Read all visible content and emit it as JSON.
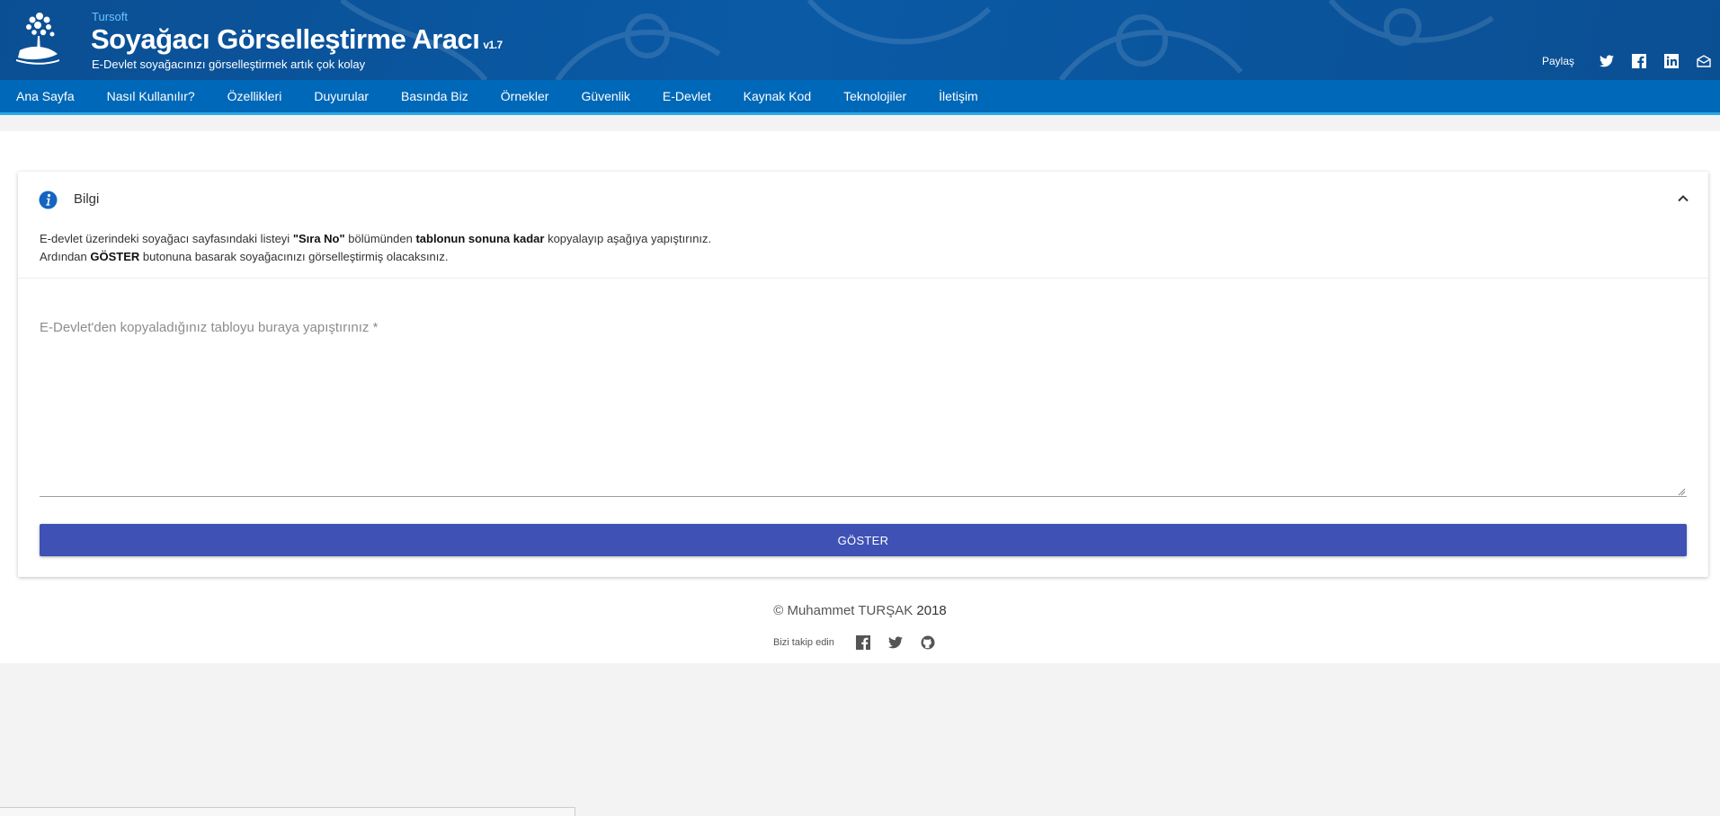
{
  "header": {
    "brand": "Tursoft",
    "title": "Soyağacı Görselleştirme Aracı",
    "version": "v1.7",
    "subtitle": "E-Devlet soyağacınızı görselleştirmek artık çok kolay",
    "share_label": "Paylaş",
    "share_icons": [
      "twitter-icon",
      "facebook-icon",
      "linkedin-icon",
      "mail-icon"
    ]
  },
  "nav": {
    "items": [
      "Ana Sayfa",
      "Nasıl Kullanılır?",
      "Özellikleri",
      "Duyurular",
      "Basında Biz",
      "Örnekler",
      "Güvenlik",
      "E-Devlet",
      "Kaynak Kod",
      "Teknolojiler",
      "İletişim"
    ]
  },
  "info": {
    "title": "Bilgi",
    "line1_a": "E-devlet üzerindeki soyağacı sayfasındaki listeyi ",
    "line1_b": "\"Sıra No\"",
    "line1_c": " bölümünden ",
    "line1_d": "tablonun sonuna kadar",
    "line1_e": " kopyalayıp aşağıya yapıştırınız.",
    "line2_a": "Ardından ",
    "line2_b": "GÖSTER",
    "line2_c": " butonuna basarak soyağacınızı görselleştirmiş olacaksınız."
  },
  "form": {
    "textarea_label": "E-Devlet'den kopyaladığınız tabloyu buraya yapıştırınız *",
    "textarea_value": "",
    "button_label": "GÖSTER"
  },
  "footer": {
    "copyright": "© Muhammet TURŞAK",
    "year": "2018",
    "follow_label": "Bizi takip edin",
    "follow_icons": [
      "facebook-icon",
      "twitter-icon",
      "github-icon"
    ]
  },
  "colors": {
    "header_bg": "#0b4f93",
    "nav_bg": "#0068b8",
    "nav_underline": "#2aa6e6",
    "button_bg": "#3f51b5",
    "brand_text": "#6ec3ff"
  }
}
